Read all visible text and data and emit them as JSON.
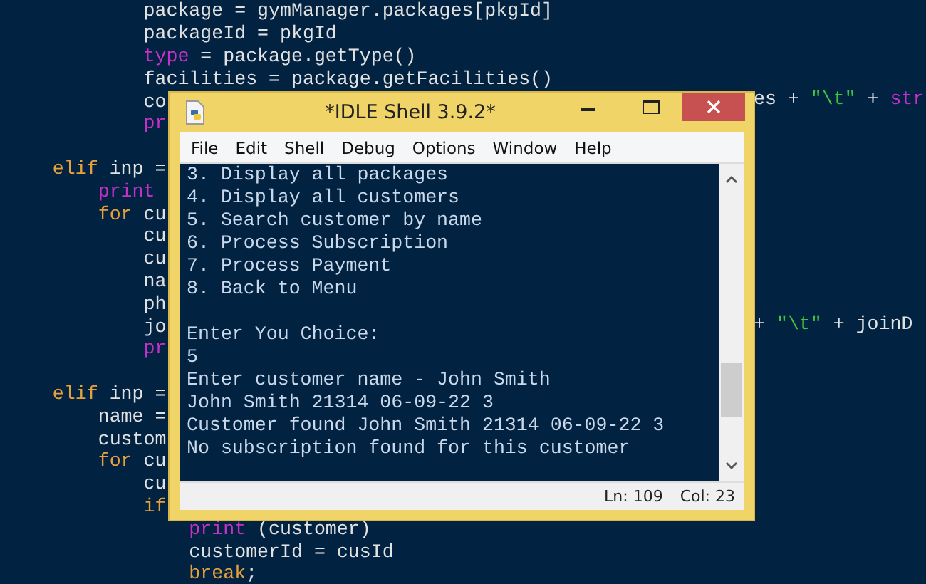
{
  "editor": {
    "lines": [
      {
        "left": [
          {
            "kind": "plain",
            "text": "            package = gymManager.packages[pkgId]"
          }
        ]
      },
      {
        "left": [
          {
            "kind": "plain",
            "text": "            packageId = pkgId"
          }
        ]
      },
      {
        "left": [
          {
            "kind": "builtin",
            "text": "            type"
          },
          {
            "kind": "plain",
            "text": " = package.getType()"
          }
        ]
      },
      {
        "left": [
          {
            "kind": "plain",
            "text": "            facilities = package.getFacilities()"
          }
        ]
      },
      {
        "left": [
          {
            "kind": "plain",
            "text": "            co"
          }
        ],
        "right": [
          {
            "kind": "plain",
            "text": "es + "
          },
          {
            "kind": "string",
            "text": "\"\\t\""
          },
          {
            "kind": "plain",
            "text": " + "
          },
          {
            "kind": "builtin",
            "text": "str"
          }
        ]
      },
      {
        "left": [
          {
            "kind": "builtin",
            "text": "            pr"
          }
        ]
      },
      {
        "gap_before": true,
        "left": [
          {
            "kind": "keyword",
            "text": "    elif"
          },
          {
            "kind": "plain",
            "text": " inp ="
          }
        ]
      },
      {
        "left": [
          {
            "kind": "builtin",
            "text": "        print"
          }
        ]
      },
      {
        "left": [
          {
            "kind": "keyword",
            "text": "        for"
          },
          {
            "kind": "plain",
            "text": " cu"
          }
        ]
      },
      {
        "left": [
          {
            "kind": "plain",
            "text": "            cu"
          }
        ]
      },
      {
        "left": [
          {
            "kind": "plain",
            "text": "            cu"
          }
        ]
      },
      {
        "left": [
          {
            "kind": "plain",
            "text": "            na"
          }
        ]
      },
      {
        "left": [
          {
            "kind": "plain",
            "text": "            ph"
          }
        ]
      },
      {
        "left": [
          {
            "kind": "plain",
            "text": "            jo"
          }
        ],
        "right": [
          {
            "kind": "plain",
            "text": "+ "
          },
          {
            "kind": "string",
            "text": "\"\\t\""
          },
          {
            "kind": "plain",
            "text": " + joinD"
          }
        ]
      },
      {
        "left": [
          {
            "kind": "builtin",
            "text": "            pr"
          }
        ]
      },
      {
        "gap_before": true,
        "left": [
          {
            "kind": "keyword",
            "text": "    elif"
          },
          {
            "kind": "plain",
            "text": " inp ="
          }
        ]
      },
      {
        "left": [
          {
            "kind": "plain",
            "text": "        name ="
          }
        ]
      },
      {
        "left": [
          {
            "kind": "plain",
            "text": "        custom"
          }
        ]
      },
      {
        "left": [
          {
            "kind": "keyword",
            "text": "        for"
          },
          {
            "kind": "plain",
            "text": " cu"
          }
        ]
      },
      {
        "left": [
          {
            "kind": "plain",
            "text": "            cu"
          }
        ]
      },
      {
        "left": [
          {
            "kind": "keyword",
            "text": "            if"
          }
        ]
      },
      {
        "left": [
          {
            "kind": "builtin",
            "text": "                print"
          },
          {
            "kind": "plain",
            "text": " (customer)"
          }
        ]
      },
      {
        "left": [
          {
            "kind": "plain",
            "text": "                customerId = cusId"
          }
        ]
      },
      {
        "left": [
          {
            "kind": "keyword",
            "text": "                break"
          },
          {
            "kind": "plain",
            "text": ";"
          }
        ]
      }
    ]
  },
  "window": {
    "title": "*IDLE Shell 3.9.2*",
    "menu": [
      "File",
      "Edit",
      "Shell",
      "Debug",
      "Options",
      "Window",
      "Help"
    ],
    "shell_lines": [
      "3. Display all packages",
      "4. Display all customers",
      "5. Search customer by name",
      "6. Process Subscription",
      "7. Process Payment",
      "8. Back to Menu",
      {
        "text": "Enter You Choice:",
        "gap_before": true
      },
      "5",
      "Enter customer name - John Smith",
      "John Smith 21314 06-09-22 3",
      "Customer found John Smith 21314 06-09-22 3",
      "No subscription found for this customer"
    ],
    "status_bar": {
      "line": "Ln: 109",
      "column": "Col: 23"
    }
  }
}
